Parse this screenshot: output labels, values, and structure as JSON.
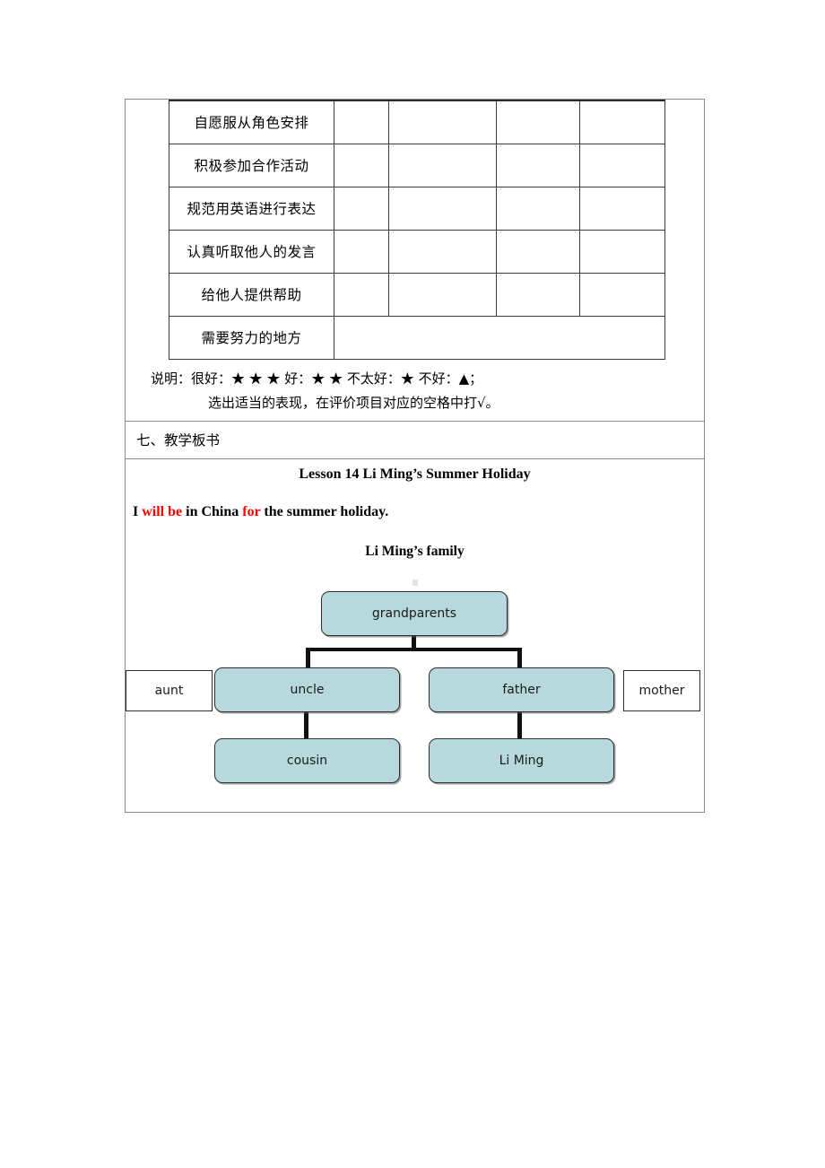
{
  "assessment": {
    "rows": [
      {
        "label": "自愿服从角色安排",
        "merged": false
      },
      {
        "label": "积极参加合作活动",
        "merged": false
      },
      {
        "label": "规范用英语进行表达",
        "merged": false
      },
      {
        "label": "认真听取他人的发言",
        "merged": false
      },
      {
        "label": "给他人提供帮助",
        "merged": false
      },
      {
        "label": "需要努力的地方",
        "merged": true
      }
    ],
    "legend_line_1": "说明：很好：★ ★ ★  好：★ ★  不太好：★  不好：▲；",
    "legend_line_2": "选出适当的表现，在评价项目对应的空格中打√。"
  },
  "section": {
    "header": "七、教学板书"
  },
  "board": {
    "title": "Lesson 14 Li Ming’s Summer Holiday",
    "sentence": {
      "part1": "I ",
      "highlight1": "will be",
      "part2": " in China ",
      "highlight2": "for",
      "part3": " the summer holiday."
    },
    "subtitle": "Li Ming’s family",
    "accent_color": "#ff0000",
    "node_fill_color": "#b7d9dd"
  },
  "family_tree": {
    "nodes": [
      {
        "id": "grandparents",
        "label": "grandparents",
        "style": "filled"
      },
      {
        "id": "aunt",
        "label": "aunt",
        "style": "plain"
      },
      {
        "id": "uncle",
        "label": "uncle",
        "style": "filled"
      },
      {
        "id": "father",
        "label": "father",
        "style": "filled"
      },
      {
        "id": "mother",
        "label": "mother",
        "style": "plain"
      },
      {
        "id": "cousin",
        "label": "cousin",
        "style": "filled"
      },
      {
        "id": "liming",
        "label": "Li Ming",
        "style": "filled"
      }
    ]
  }
}
